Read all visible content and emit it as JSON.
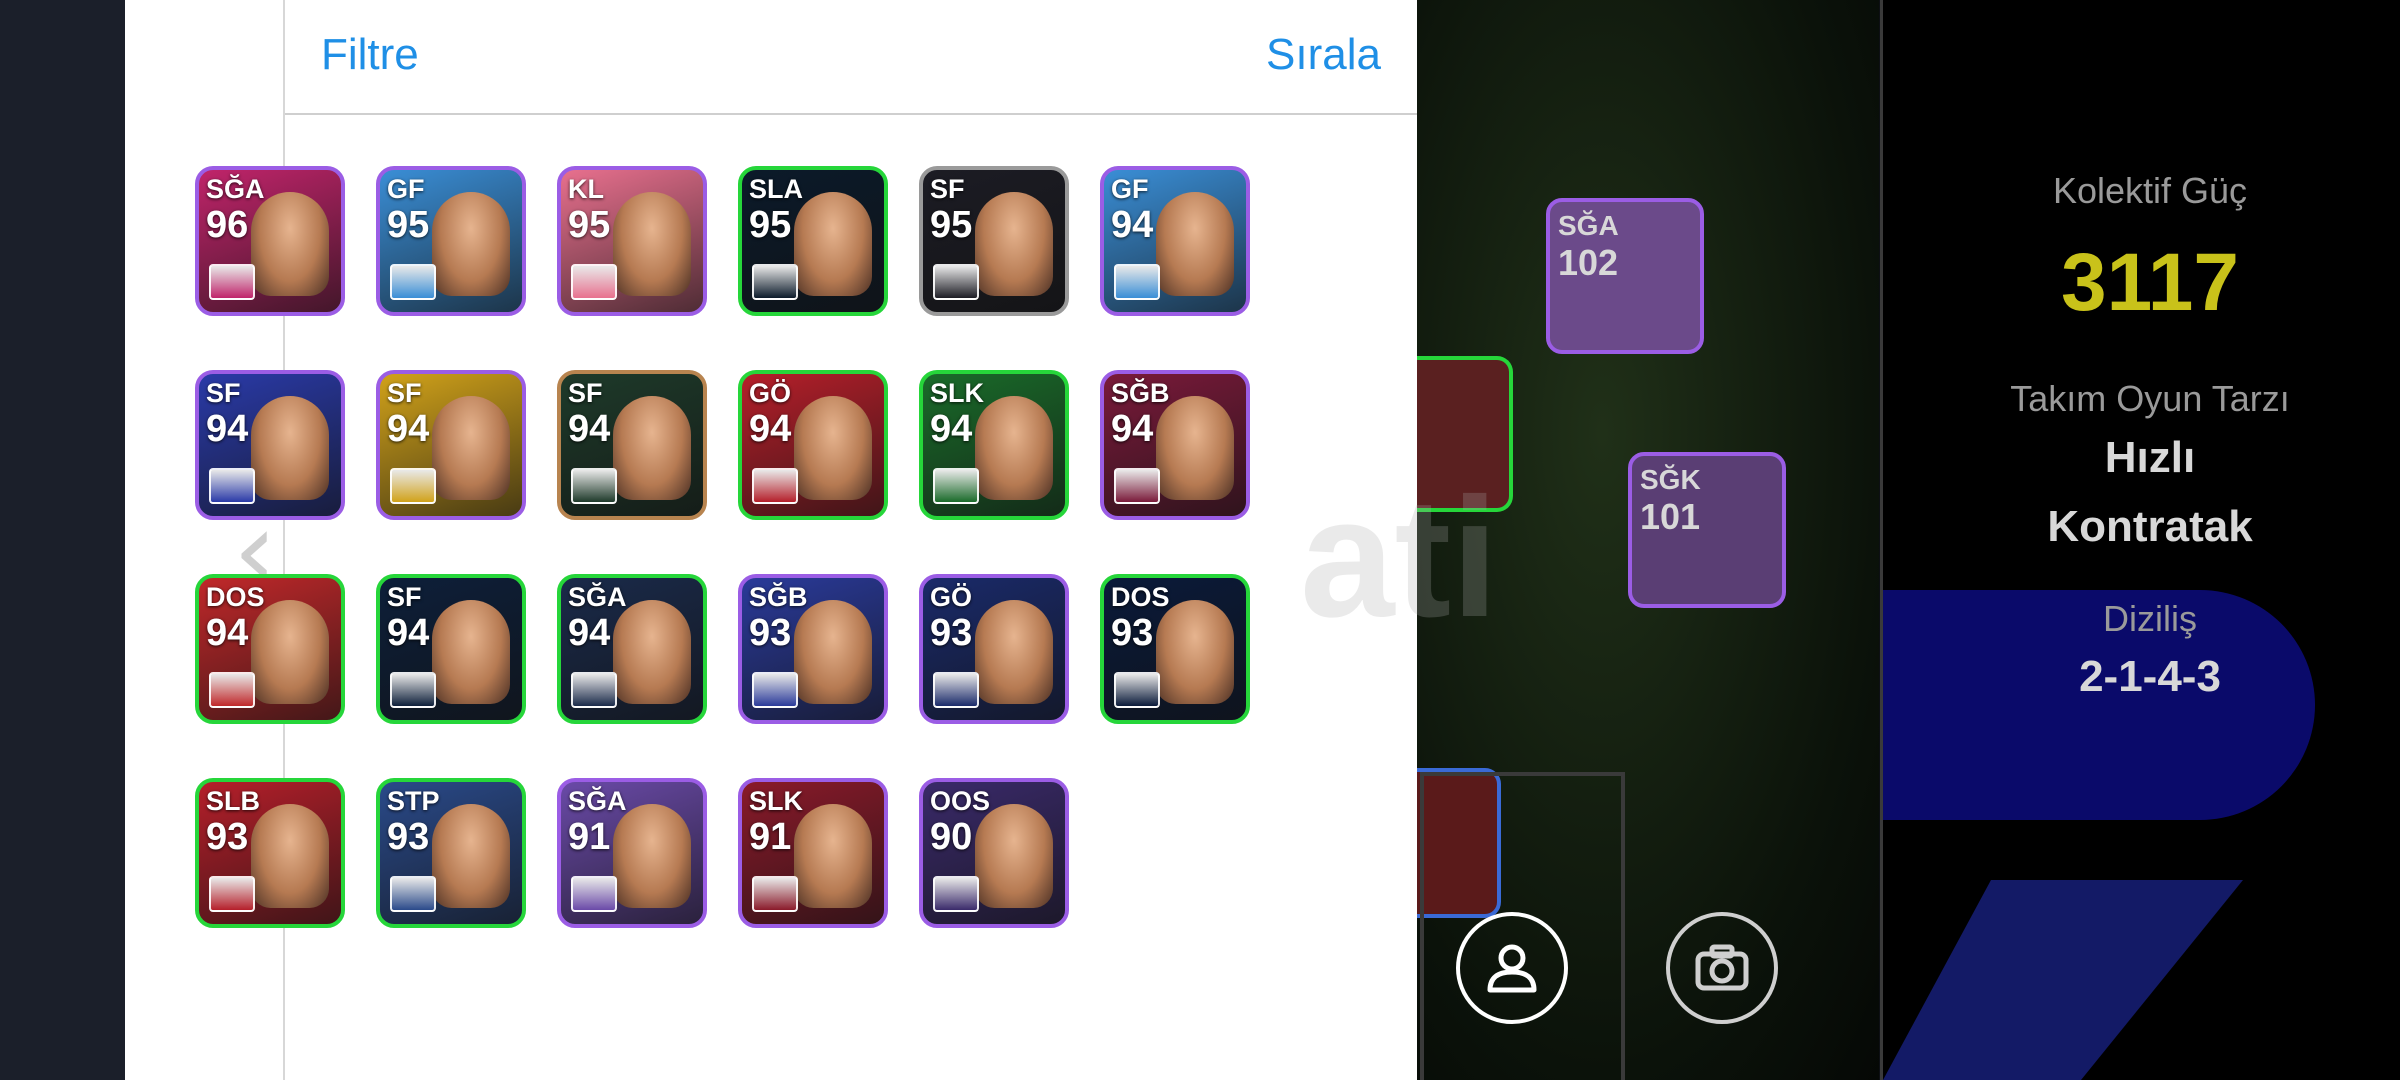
{
  "drawer": {
    "filter_label": "Filtre",
    "sort_label": "Sırala"
  },
  "colors": {
    "accent_blue": "#1f8fe6",
    "border_purple": "#9b5de5",
    "border_green": "#26d63a",
    "border_bronze": "#b8844f",
    "border_silver": "#9a9a9a",
    "power_yellow": "#c9c21a"
  },
  "cards": [
    {
      "pos": "SĞA",
      "rating": "96",
      "border": "#9b5de5",
      "bg": "#c0246a",
      "badge": "egypt-flag-icon"
    },
    {
      "pos": "GF",
      "rating": "95",
      "border": "#9b5de5",
      "bg": "#3a8ed6",
      "badge": "brazil-flag-icon"
    },
    {
      "pos": "KL",
      "rating": "95",
      "border": "#9b5de5",
      "bg": "#e8708e",
      "badge": "bayern-crest-icon"
    },
    {
      "pos": "SLA",
      "rating": "95",
      "border": "#26d63a",
      "bg": "#0b1a2a",
      "badge": "club-crest-icon"
    },
    {
      "pos": "SF",
      "rating": "95",
      "border": "#9a9a9a",
      "bg": "#1c1c24",
      "badge": "manchester-city-crest-icon"
    },
    {
      "pos": "GF",
      "rating": "94",
      "border": "#9b5de5",
      "bg": "#3a8ed6",
      "badge": "marseille-crest-icon"
    },
    {
      "pos": "SF",
      "rating": "94",
      "border": "#9b5de5",
      "bg": "#2a3aa8",
      "badge": "sweden-flag-icon"
    },
    {
      "pos": "SF",
      "rating": "94",
      "border": "#9b5de5",
      "bg": "#d1a21a",
      "badge": "club-crest-icon"
    },
    {
      "pos": "SF",
      "rating": "94",
      "border": "#b8844f",
      "bg": "#1e3a2a",
      "badge": "malaysia-flag-icon"
    },
    {
      "pos": "GÖ",
      "rating": "94",
      "border": "#26d63a",
      "bg": "#b51f2a",
      "badge": "athletic-crest-icon"
    },
    {
      "pos": "SLK",
      "rating": "94",
      "border": "#26d63a",
      "bg": "#1a6b2a",
      "badge": "barcelona-crest-icon"
    },
    {
      "pos": "SĞB",
      "rating": "94",
      "border": "#9b5de5",
      "bg": "#7a1a3a",
      "badge": "athletic-crest-icon"
    },
    {
      "pos": "DOS",
      "rating": "94",
      "border": "#26d63a",
      "bg": "#c0282a",
      "badge": "spain-flag-icon"
    },
    {
      "pos": "SF",
      "rating": "94",
      "border": "#26d63a",
      "bg": "#0d1f3a",
      "badge": "inter-crest-icon"
    },
    {
      "pos": "SĞA",
      "rating": "94",
      "border": "#26d63a",
      "bg": "#1a2a4a",
      "badge": "psg-crest-icon"
    },
    {
      "pos": "SĞB",
      "rating": "93",
      "border": "#9b5de5",
      "bg": "#2a3a9a",
      "badge": "spain-flag-icon"
    },
    {
      "pos": "GÖ",
      "rating": "93",
      "border": "#9b5de5",
      "bg": "#1a2a6a",
      "badge": "inter-crest-icon"
    },
    {
      "pos": "DOS",
      "rating": "93",
      "border": "#26d63a",
      "bg": "#0a1a3a",
      "badge": "atalanta-crest-icon"
    },
    {
      "pos": "SLB",
      "rating": "93",
      "border": "#26d63a",
      "bg": "#b51f2a",
      "badge": "club-crest-icon"
    },
    {
      "pos": "STP",
      "rating": "93",
      "border": "#26d63a",
      "bg": "#2a4a8a",
      "badge": "italy-flag-icon"
    },
    {
      "pos": "SĞA",
      "rating": "91",
      "border": "#9b5de5",
      "bg": "#6a4aa8",
      "badge": "vissel-kobe-crest-icon"
    },
    {
      "pos": "SLK",
      "rating": "91",
      "border": "#9b5de5",
      "bg": "#8a1a2a",
      "badge": "galatasaray-crest-icon"
    },
    {
      "pos": "OOS",
      "rating": "90",
      "border": "#9b5de5",
      "bg": "#3a2a6a",
      "badge": "lille-crest-icon"
    }
  ],
  "pitch_cards": [
    {
      "pos": "SĞA",
      "rating": "102"
    },
    {
      "pos": "SĞK",
      "rating": "101"
    }
  ],
  "watermark": "ati",
  "right_panel": {
    "collective_label": "Kolektif Güç",
    "collective_value": "3117",
    "play_style_label": "Takım Oyun Tarzı",
    "play_style_line1": "Hızlı",
    "play_style_line2": "Kontratak",
    "formation_label": "Diziliş",
    "formation_value": "2-1-4-3"
  }
}
